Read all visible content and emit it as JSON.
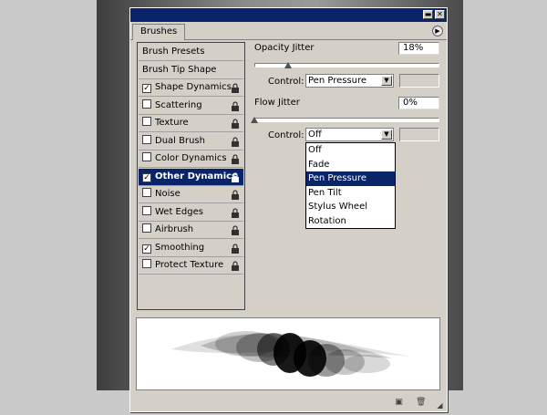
{
  "panel": {
    "tab_label": "Brushes",
    "minimize_icon": "minimize-icon",
    "close_icon": "close-icon"
  },
  "sidebar": {
    "items": [
      {
        "label": "Brush Presets",
        "checkbox": false,
        "checked": false,
        "lock": false,
        "selected": false
      },
      {
        "label": "Brush Tip Shape",
        "checkbox": false,
        "checked": false,
        "lock": false,
        "selected": false
      },
      {
        "label": "Shape Dynamics",
        "checkbox": true,
        "checked": true,
        "lock": true,
        "selected": false
      },
      {
        "label": "Scattering",
        "checkbox": true,
        "checked": false,
        "lock": true,
        "selected": false
      },
      {
        "label": "Texture",
        "checkbox": true,
        "checked": false,
        "lock": true,
        "selected": false
      },
      {
        "label": "Dual Brush",
        "checkbox": true,
        "checked": false,
        "lock": true,
        "selected": false
      },
      {
        "label": "Color Dynamics",
        "checkbox": true,
        "checked": false,
        "lock": true,
        "selected": false
      },
      {
        "label": "Other Dynamics",
        "checkbox": true,
        "checked": true,
        "lock": true,
        "selected": true
      },
      {
        "label": "Noise",
        "checkbox": true,
        "checked": false,
        "lock": true,
        "selected": false
      },
      {
        "label": "Wet Edges",
        "checkbox": true,
        "checked": false,
        "lock": true,
        "selected": false
      },
      {
        "label": "Airbrush",
        "checkbox": true,
        "checked": false,
        "lock": true,
        "selected": false
      },
      {
        "label": "Smoothing",
        "checkbox": true,
        "checked": true,
        "lock": true,
        "selected": false
      },
      {
        "label": "Protect Texture",
        "checkbox": true,
        "checked": false,
        "lock": true,
        "selected": false
      }
    ]
  },
  "opacity": {
    "label": "Opacity Jitter",
    "value": "18%",
    "slider_fraction": 0.18,
    "control_label": "Control:",
    "control_value": "Pen Pressure"
  },
  "flow": {
    "label": "Flow Jitter",
    "value": "0%",
    "slider_fraction": 0.0,
    "control_label": "Control:",
    "control_value": "Off"
  },
  "dropdown": {
    "options": [
      "Off",
      "Fade",
      "Pen Pressure",
      "Pen Tilt",
      "Stylus Wheel",
      "Rotation"
    ],
    "highlighted": "Pen Pressure"
  },
  "icons": {
    "check": "✓",
    "lock": "🔒",
    "arrow": "▼",
    "menu": "▶",
    "new_preset": "new-preset-icon",
    "trash": "trash-icon"
  }
}
